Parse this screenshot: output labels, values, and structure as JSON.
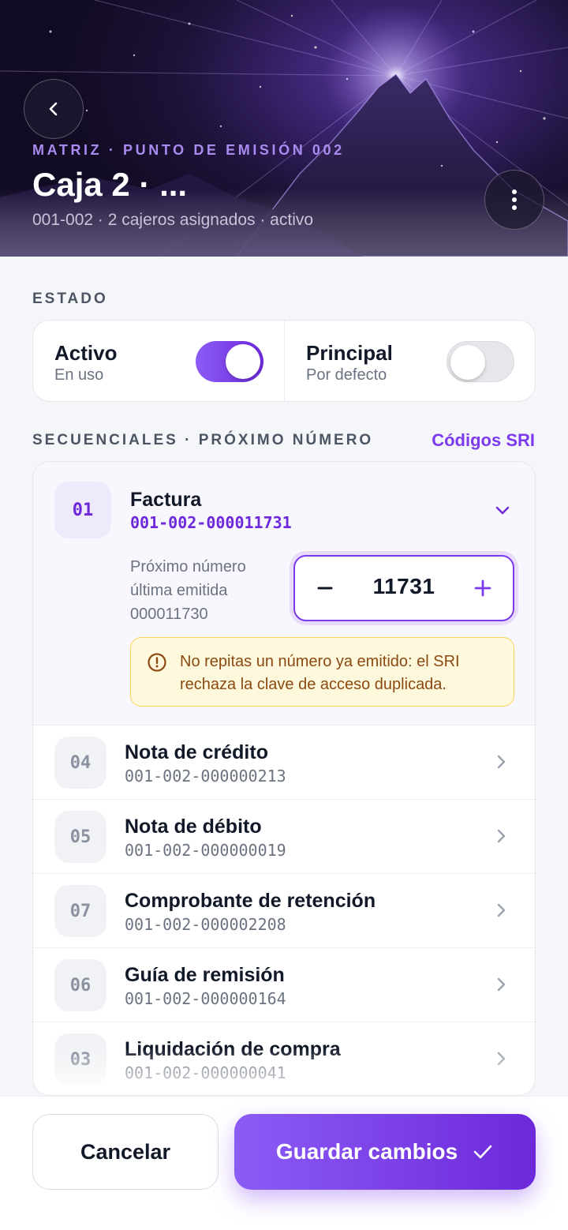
{
  "header": {
    "eyebrow": "MATRIZ · PUNTO DE EMISIÓN 002",
    "title": "Caja 2 · ...",
    "subtitle": "001-002 · 2 cajeros asignados · activo",
    "back_icon": "chevron-left-icon",
    "more_icon": "vertical-dots-icon"
  },
  "estado": {
    "label": "ESTADO",
    "activo": {
      "title": "Activo",
      "subtitle": "En uso",
      "on": true
    },
    "principal": {
      "title": "Principal",
      "subtitle": "Por defecto",
      "on": false
    }
  },
  "secuenciales": {
    "label": "SECUENCIALES · PRÓXIMO NÚMERO",
    "link": "Códigos SRI",
    "expanded": {
      "code": "01",
      "name": "Factura",
      "number": "001-002-000011731",
      "next_label_line1": "Próximo número",
      "next_label_line2": "última emitida",
      "last_emitted": "000011730",
      "stepper_value": "11731",
      "minus": "–",
      "plus": "+",
      "warning": "No repitas un número ya emitido: el SRI rechaza la clave de acceso duplicada."
    },
    "rows": [
      {
        "code": "04",
        "name": "Nota de crédito",
        "number": "001-002-000000213"
      },
      {
        "code": "05",
        "name": "Nota de débito",
        "number": "001-002-000000019"
      },
      {
        "code": "07",
        "name": "Comprobante de retención",
        "number": "001-002-000002208"
      },
      {
        "code": "06",
        "name": "Guía de remisión",
        "number": "001-002-000000164"
      },
      {
        "code": "03",
        "name": "Liquidación de compra",
        "number": "001-002-000000041"
      }
    ]
  },
  "footer": {
    "cancel": "Cancelar",
    "save": "Guardar cambios"
  },
  "colors": {
    "accent": "#7c3aed",
    "accent_light": "#8b5cf6",
    "warning_bg": "#fef8dc",
    "warning_text": "#8a4a12",
    "hero_bg": "#1d1238"
  }
}
